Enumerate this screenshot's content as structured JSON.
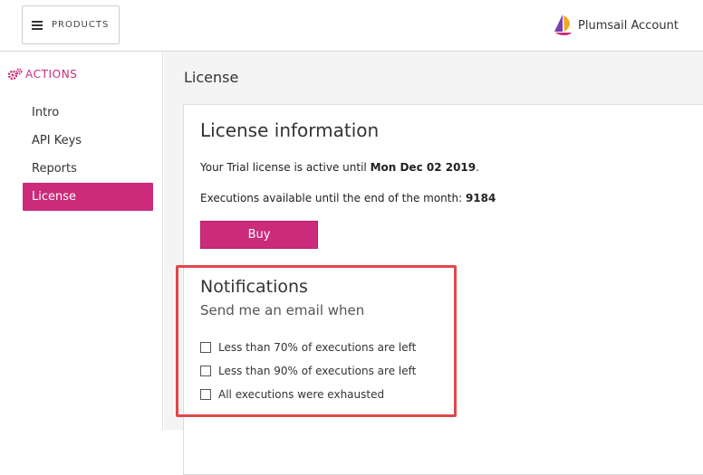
{
  "topbar": {
    "products_label": "PRODUCTS",
    "account_label": "Plumsail Account"
  },
  "sidebar": {
    "header_label": "ACTIONS",
    "items": [
      {
        "label": "Intro"
      },
      {
        "label": "API Keys"
      },
      {
        "label": "Reports"
      },
      {
        "label": "License",
        "active": true
      }
    ]
  },
  "main": {
    "page_title": "License",
    "card": {
      "title": "License information",
      "trial_prefix": "Your Trial license is active until ",
      "trial_date": "Mon Dec 02 2019",
      "trial_suffix": ".",
      "executions_prefix": "Executions available until the end of the month: ",
      "executions_count": "9184",
      "buy_label": "Buy"
    },
    "notifications": {
      "title": "Notifications",
      "subtitle": "Send me an email when",
      "options": [
        {
          "label": "Less than 70% of executions are left",
          "checked": false
        },
        {
          "label": "Less than 90% of executions are left",
          "checked": false
        },
        {
          "label": "All executions were exhausted",
          "checked": false
        }
      ]
    }
  },
  "colors": {
    "accent": "#cc2a7b",
    "highlight": "#e0474c"
  },
  "icons": [
    "hamburger-icon",
    "plumsail-logo-icon",
    "cogs-icon",
    "checkbox-icon"
  ]
}
